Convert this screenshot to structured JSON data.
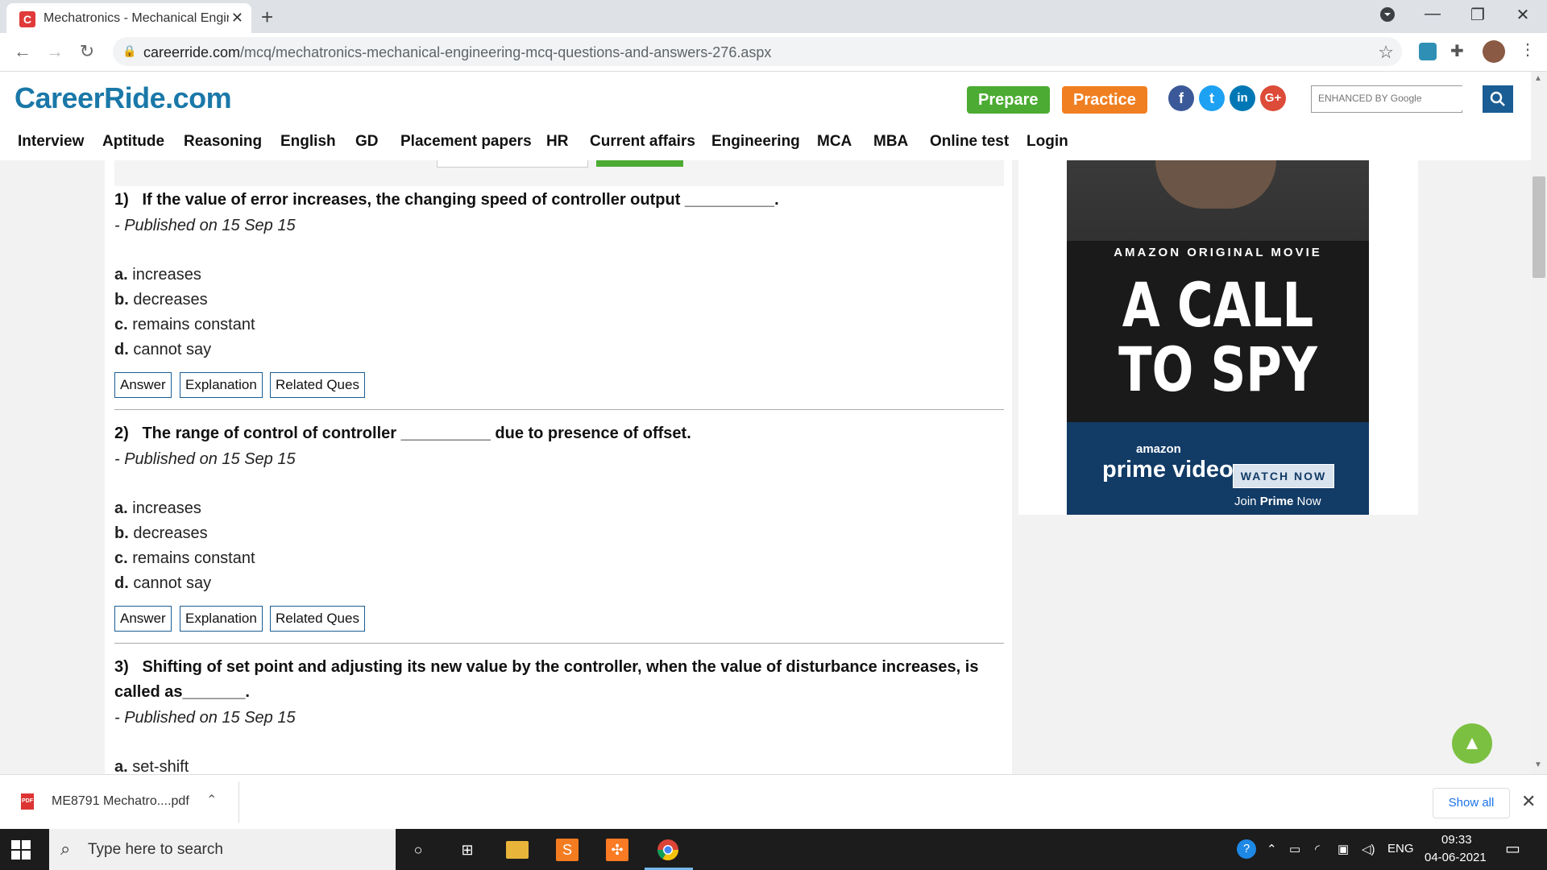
{
  "browser": {
    "tab_title": "Mechatronics - Mechanical Engin",
    "tab_favicon": "C",
    "url_host": "careerride.com",
    "url_path": "/mcq/mechatronics-mechanical-engineering-mcq-questions-and-answers-276.aspx"
  },
  "site": {
    "logo": "CareerRide.com",
    "prepare_label": "Prepare",
    "practice_label": "Practice",
    "search_placeholder": "ENHANCED BY Google",
    "nav": [
      "Interview",
      "Aptitude",
      "Reasoning",
      "English",
      "GD",
      "Placement papers",
      "HR",
      "Current affairs",
      "Engineering",
      "MCA",
      "MBA",
      "Online test",
      "Login"
    ]
  },
  "questions": [
    {
      "number": "1)",
      "text": "If the value of error increases, the changing speed of controller output __________.",
      "published": "- Published on 15 Sep 15",
      "options": [
        {
          "letter": "a.",
          "text": "increases"
        },
        {
          "letter": "b.",
          "text": "decreases"
        },
        {
          "letter": "c.",
          "text": "remains constant"
        },
        {
          "letter": "d.",
          "text": "cannot say"
        }
      ]
    },
    {
      "number": "2)",
      "text": "The range of control of controller __________ due to presence of offset.",
      "published": "- Published on 15 Sep 15",
      "options": [
        {
          "letter": "a.",
          "text": "increases"
        },
        {
          "letter": "b.",
          "text": "decreases"
        },
        {
          "letter": "c.",
          "text": "remains constant"
        },
        {
          "letter": "d.",
          "text": "cannot say"
        }
      ]
    },
    {
      "number": "3)",
      "text": "Shifting of set point and adjusting its new value by the controller, when the value of disturbance increases, is called as_______.",
      "published": "- Published on 15 Sep 15",
      "options": [
        {
          "letter": "a.",
          "text": "set-shift"
        }
      ]
    }
  ],
  "question_buttons": {
    "answer": "Answer",
    "explanation": "Explanation",
    "related": "Related Ques"
  },
  "ad": {
    "tagline": "AMAZON ORIGINAL MOVIE",
    "title_line1": "A CALL",
    "title_line2": "TO SPY",
    "brand_small": "amazon",
    "brand": "prime video",
    "cta": "WATCH NOW",
    "join_prefix": "Join ",
    "join_bold": "Prime",
    "join_suffix": " Now"
  },
  "download": {
    "filename": "ME8791 Mechatro....pdf",
    "show_all": "Show all"
  },
  "taskbar": {
    "search_placeholder": "Type here to search",
    "language": "ENG",
    "time": "09:33",
    "date": "04-06-2021"
  },
  "colors": {
    "brand": "#1a78a8",
    "prepare": "#4bab32",
    "practice": "#f07f21",
    "button_border": "#1a5d94"
  }
}
